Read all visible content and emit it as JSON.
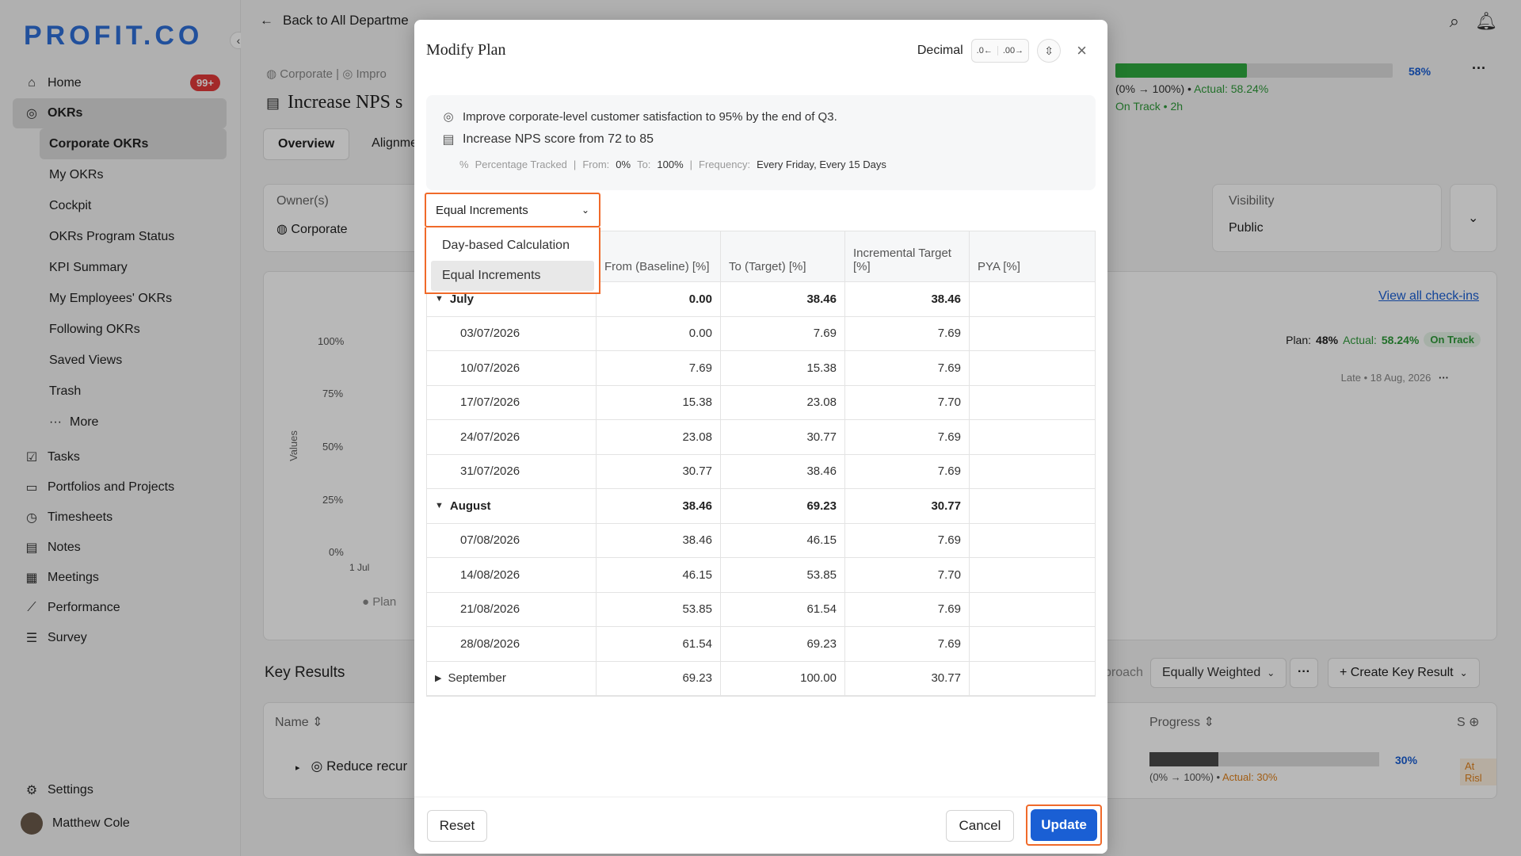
{
  "app": {
    "logo": "PROFIT.CO"
  },
  "sidebar": {
    "home": "Home",
    "home_badge": "99+",
    "okrs": "OKRs",
    "sub": [
      "Corporate OKRs",
      "My OKRs",
      "Cockpit",
      "OKRs Program Status",
      "KPI Summary",
      "My Employees' OKRs",
      "Following OKRs",
      "Saved Views",
      "Trash",
      "More"
    ],
    "items": [
      "Tasks",
      "Portfolios and Projects",
      "Timesheets",
      "Notes",
      "Meetings",
      "Performance",
      "Survey"
    ],
    "settings": "Settings",
    "user": "Matthew Cole"
  },
  "page": {
    "back": "Back to All Departme",
    "breadcrumb_1": "Corporate",
    "breadcrumb_2": "Impro",
    "title": "Increase NPS s",
    "tab_overview": "Overview",
    "tab_alignment": "Alignme",
    "owner_label": "Owner(s)",
    "owner_value": "Corporate",
    "visibility_label": "Visibility",
    "visibility_value": "Public",
    "progress_pct": "58%",
    "progress_range": "(0% → 100%) •",
    "progress_actual": "Actual: 58.24%",
    "status": "On Track • 2h",
    "view_checkins": "View all check-ins",
    "plan_label": "Plan:",
    "plan_value": "48%",
    "actual_label": "Actual:",
    "actual_value": "58.24%",
    "on_track": "On Track",
    "late": "Late • 18 Aug, 2026",
    "chart_y": [
      "100%",
      "75%",
      "50%",
      "25%",
      "0%"
    ],
    "chart_ylabel": "Values",
    "chart_x": "1 Jul",
    "chart_legend": "Plan",
    "key_results": "Key Results",
    "approach": "proach",
    "weighting": "Equally Weighted",
    "create_kr": "+ Create Key Result",
    "col_name": "Name",
    "col_progress": "Progress",
    "col_s": "S",
    "kr_name": "Reduce recur",
    "kr_pct": "30%",
    "kr_range": "(0% → 100%) •",
    "kr_actual": "Actual: 30%",
    "kr_status": "At Risl"
  },
  "modal": {
    "title": "Modify Plan",
    "decimal_label": "Decimal",
    "dec_less": ".0←",
    "dec_more": ".00→",
    "objective": "Improve corporate-level customer satisfaction to 95% by the end of Q3.",
    "key_result": "Increase NPS score from 72 to 85",
    "meta_tracked": "Percentage Tracked",
    "meta_from_label": "From:",
    "meta_from": "0%",
    "meta_to_label": "To:",
    "meta_to": "100%",
    "meta_freq_label": "Frequency:",
    "meta_freq": "Every Friday, Every 15 Days",
    "dropdown_value": "Equal Increments",
    "options": [
      "Day-based Calculation",
      "Equal Increments"
    ],
    "headers": [
      "",
      "From (Baseline) [%]",
      "To (Target) [%]",
      "Incremental Target [%]",
      "PYA [%]"
    ],
    "rows": [
      {
        "type": "group",
        "label": "July",
        "from": "0.00",
        "to": "38.46",
        "inc": "38.46",
        "pya": ""
      },
      {
        "type": "sub",
        "label": "03/07/2026",
        "from": "0.00",
        "to": "7.69",
        "inc": "7.69",
        "pya": ""
      },
      {
        "type": "sub",
        "label": "10/07/2026",
        "from": "7.69",
        "to": "15.38",
        "inc": "7.69",
        "pya": ""
      },
      {
        "type": "sub",
        "label": "17/07/2026",
        "from": "15.38",
        "to": "23.08",
        "inc": "7.70",
        "pya": ""
      },
      {
        "type": "sub",
        "label": "24/07/2026",
        "from": "23.08",
        "to": "30.77",
        "inc": "7.69",
        "pya": ""
      },
      {
        "type": "sub",
        "label": "31/07/2026",
        "from": "30.77",
        "to": "38.46",
        "inc": "7.69",
        "pya": ""
      },
      {
        "type": "group",
        "label": "August",
        "from": "38.46",
        "to": "69.23",
        "inc": "30.77",
        "pya": ""
      },
      {
        "type": "sub",
        "label": "07/08/2026",
        "from": "38.46",
        "to": "46.15",
        "inc": "7.69",
        "pya": ""
      },
      {
        "type": "sub",
        "label": "14/08/2026",
        "from": "46.15",
        "to": "53.85",
        "inc": "7.70",
        "pya": ""
      },
      {
        "type": "sub",
        "label": "21/08/2026",
        "from": "53.85",
        "to": "61.54",
        "inc": "7.69",
        "pya": ""
      },
      {
        "type": "sub",
        "label": "28/08/2026",
        "from": "61.54",
        "to": "69.23",
        "inc": "7.69",
        "pya": ""
      },
      {
        "type": "collapsed",
        "label": "September",
        "from": "69.23",
        "to": "100.00",
        "inc": "30.77",
        "pya": ""
      }
    ],
    "reset": "Reset",
    "cancel": "Cancel",
    "update": "Update"
  },
  "colors": {
    "accent": "#1a5fd4",
    "highlight": "#f06a2a",
    "on_track": "#2faa3f",
    "at_risk": "#e0821c"
  }
}
